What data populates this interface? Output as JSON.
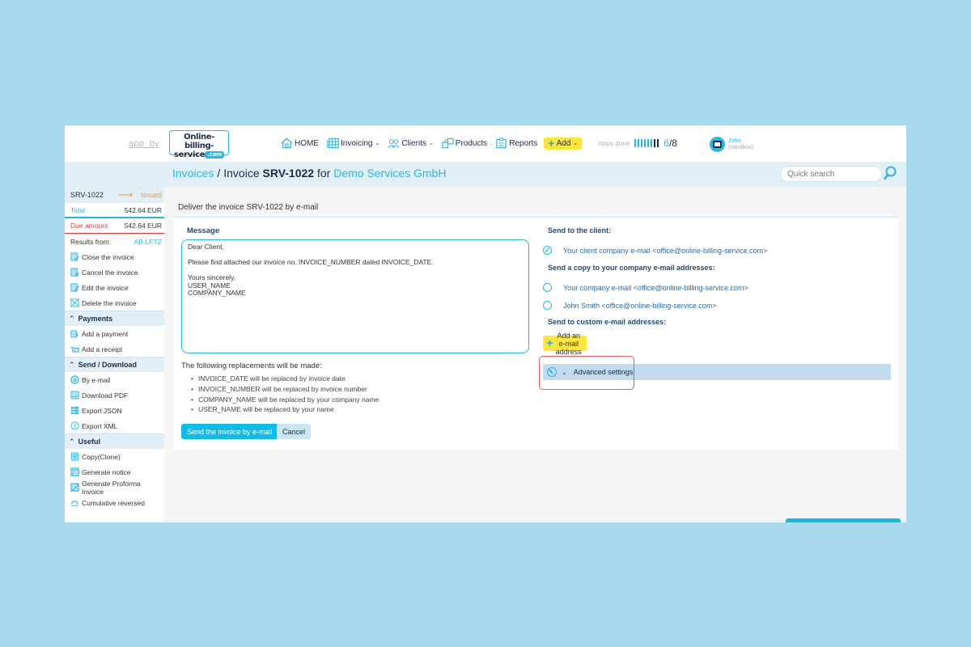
{
  "header": {
    "app_by": "app_by",
    "logo_line1": "Online-billing-",
    "logo_line2": "service",
    "logo_com": ".com",
    "nav": [
      {
        "icon": "home-icon",
        "label": "HOME"
      },
      {
        "icon": "invoicing-icon",
        "label": "Invoicing",
        "dropdown": true
      },
      {
        "icon": "clients-icon",
        "label": "Clients",
        "dropdown": true
      },
      {
        "icon": "products-icon",
        "label": "Products"
      },
      {
        "icon": "reports-icon",
        "label": "Reports"
      }
    ],
    "add_label": "Add",
    "steps_label": "steps done",
    "steps_done": "6",
    "steps_total": "/8",
    "steps_progress": {
      "done": 6,
      "total": 8
    },
    "user_name": "John",
    "user_sub": "(sandbox)"
  },
  "breadcrumb": {
    "root": "Invoices",
    "separator": "/",
    "invoice_prefix": "Invoice",
    "invoice_number": "SRV-1022",
    "for": "for",
    "client": "Demo Services GmbH"
  },
  "search": {
    "placeholder": "Quick search",
    "value": "Quick search"
  },
  "sidebar": {
    "invoice_number": "SRV-1022",
    "arrow": "⟶",
    "status": "issued",
    "total_label": "Total",
    "total_value": "542.64 EUR",
    "due_label": "Due amount",
    "due_value": "542.64 EUR",
    "results_label": "Results from:",
    "results_value": "AB-LFTZ",
    "actions": [
      {
        "icon": "close-invoice-icon",
        "label": "Close the invoice"
      },
      {
        "icon": "cancel-invoice-icon",
        "label": "Cancel the invoice"
      },
      {
        "icon": "edit-invoice-icon",
        "label": "Edit the invoice"
      },
      {
        "icon": "delete-invoice-icon",
        "label": "Delete the invoice"
      }
    ],
    "sections": [
      {
        "title": "Payments",
        "items": [
          {
            "icon": "payment-icon",
            "label": "Add a payment"
          },
          {
            "icon": "receipt-icon",
            "label": "Add a receipt"
          }
        ]
      },
      {
        "title": "Send / Download",
        "items": [
          {
            "icon": "email-icon",
            "label": "By e-mail"
          },
          {
            "icon": "pdf-icon",
            "label": "Download PDF"
          },
          {
            "icon": "json-icon",
            "label": "Export JSON"
          },
          {
            "icon": "xml-icon",
            "label": "Export XML"
          }
        ]
      },
      {
        "title": "Useful",
        "items": [
          {
            "icon": "copy-icon",
            "label": "Copy(Clone)"
          },
          {
            "icon": "notice-icon",
            "label": "Generate notice"
          },
          {
            "icon": "proforma-icon",
            "label": "Generate Proforma Invoice"
          },
          {
            "icon": "reversed-icon",
            "label": "Cumulative reversed"
          }
        ]
      }
    ]
  },
  "panel": {
    "title": "Deliver the invoice SRV-1022 by e-mail",
    "message_label": "Message",
    "message_text": "Dear Client,\n\nPlease find attached our invoice no. INVOICE_NUMBER dated INVOICE_DATE.\n\nYours sincerely,\nUSER_NAME\nCOMPANY_NAME",
    "replacements_title": "The following replacements will be made:",
    "replacements": [
      "INVOICE_DATE will be replaced by invoice date",
      "INVOICE_NUMBER will be replaced by invoice number",
      "COMPANY_NAME will be replaced by your company name",
      "USER_NAME will be replaced by your name"
    ],
    "send_button": "Send the invoice by e-mail",
    "cancel_button": "Cancel",
    "send_to_client_label": "Send to the client:",
    "client_email": {
      "label": "Your client company e-mail <office@online-billing-service.com>",
      "checked": true
    },
    "copy_label": "Send a copy to your company e-mail addresses:",
    "company_emails": [
      {
        "label": "Your company e-mail <office@online-billing-service.com>",
        "checked": false
      },
      {
        "label": "John Smith <office@online-billing-service.com>",
        "checked": false
      }
    ],
    "custom_label": "Send to custom e-mail addresses:",
    "add_email_button": "Add an e-mail address",
    "advanced_settings": "Advanced settings"
  },
  "colors": {
    "accent": "#29b6e8",
    "brand_dark": "#1d2b4a",
    "highlight_yellow": "#fde63b",
    "status_issued": "#f29b32",
    "due_red": "#e53935",
    "page_background": "#a8d9ee"
  }
}
